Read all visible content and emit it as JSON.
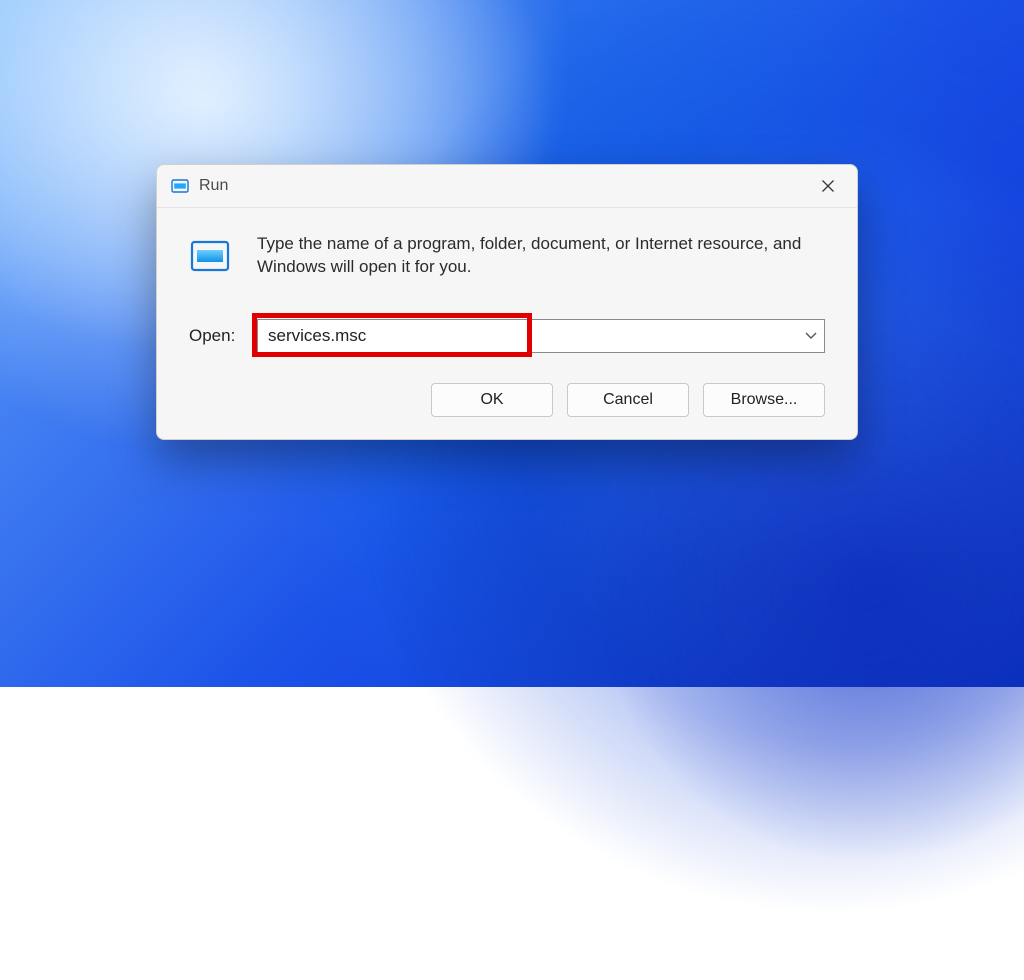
{
  "dialog": {
    "title": "Run",
    "instruction": "Type the name of a program, folder, document, or Internet resource, and Windows will open it for you.",
    "open_label": "Open:",
    "input_value": "services.msc",
    "buttons": {
      "ok": "OK",
      "cancel": "Cancel",
      "browse": "Browse..."
    }
  }
}
